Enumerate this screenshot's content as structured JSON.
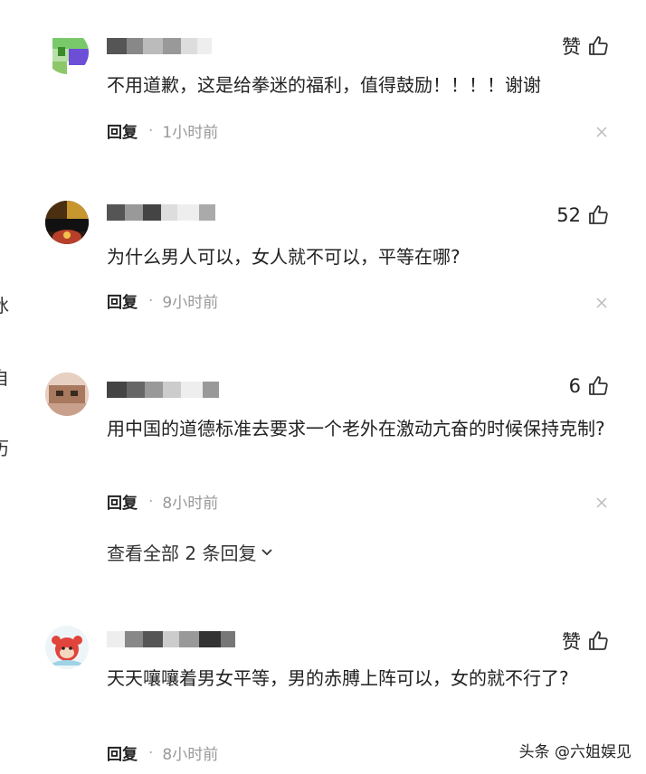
{
  "edge_chars": [
    "冰",
    "自",
    "历"
  ],
  "comments": [
    {
      "username": "勇惹回公…",
      "likes": "赞",
      "text": "不用道歉，这是给拳迷的福利，值得鼓励！！！！谢谢",
      "reply_label": "回复",
      "separator": "·",
      "time": "1小时前",
      "close_icon": "close-icon"
    },
    {
      "username": "西…",
      "likes": "52",
      "text": "为什么男人可以，女人就不可以，平等在哪?",
      "reply_label": "回复",
      "separator": "·",
      "time": "9小时前",
      "close_icon": "close-icon"
    },
    {
      "username": "另老…八",
      "likes": "6",
      "text": "用中国的道德标准去要求一个老外在激动亢奋的时候保持克制?",
      "reply_label": "回复",
      "separator": "·",
      "time": "8小时前",
      "close_icon": "close-icon",
      "expand_label": "查看全部 2 条回复"
    },
    {
      "username": "…上…",
      "likes": "赞",
      "text": "天天嚷嚷着男女平等，男的赤膊上阵可以，女的就不行了?",
      "reply_label": "回复",
      "separator": "·",
      "time": "8小时前"
    }
  ],
  "watermark": "头条 @六姐娱见",
  "colors": {
    "text": "#222222",
    "meta": "#999999",
    "icon": "#333333"
  }
}
